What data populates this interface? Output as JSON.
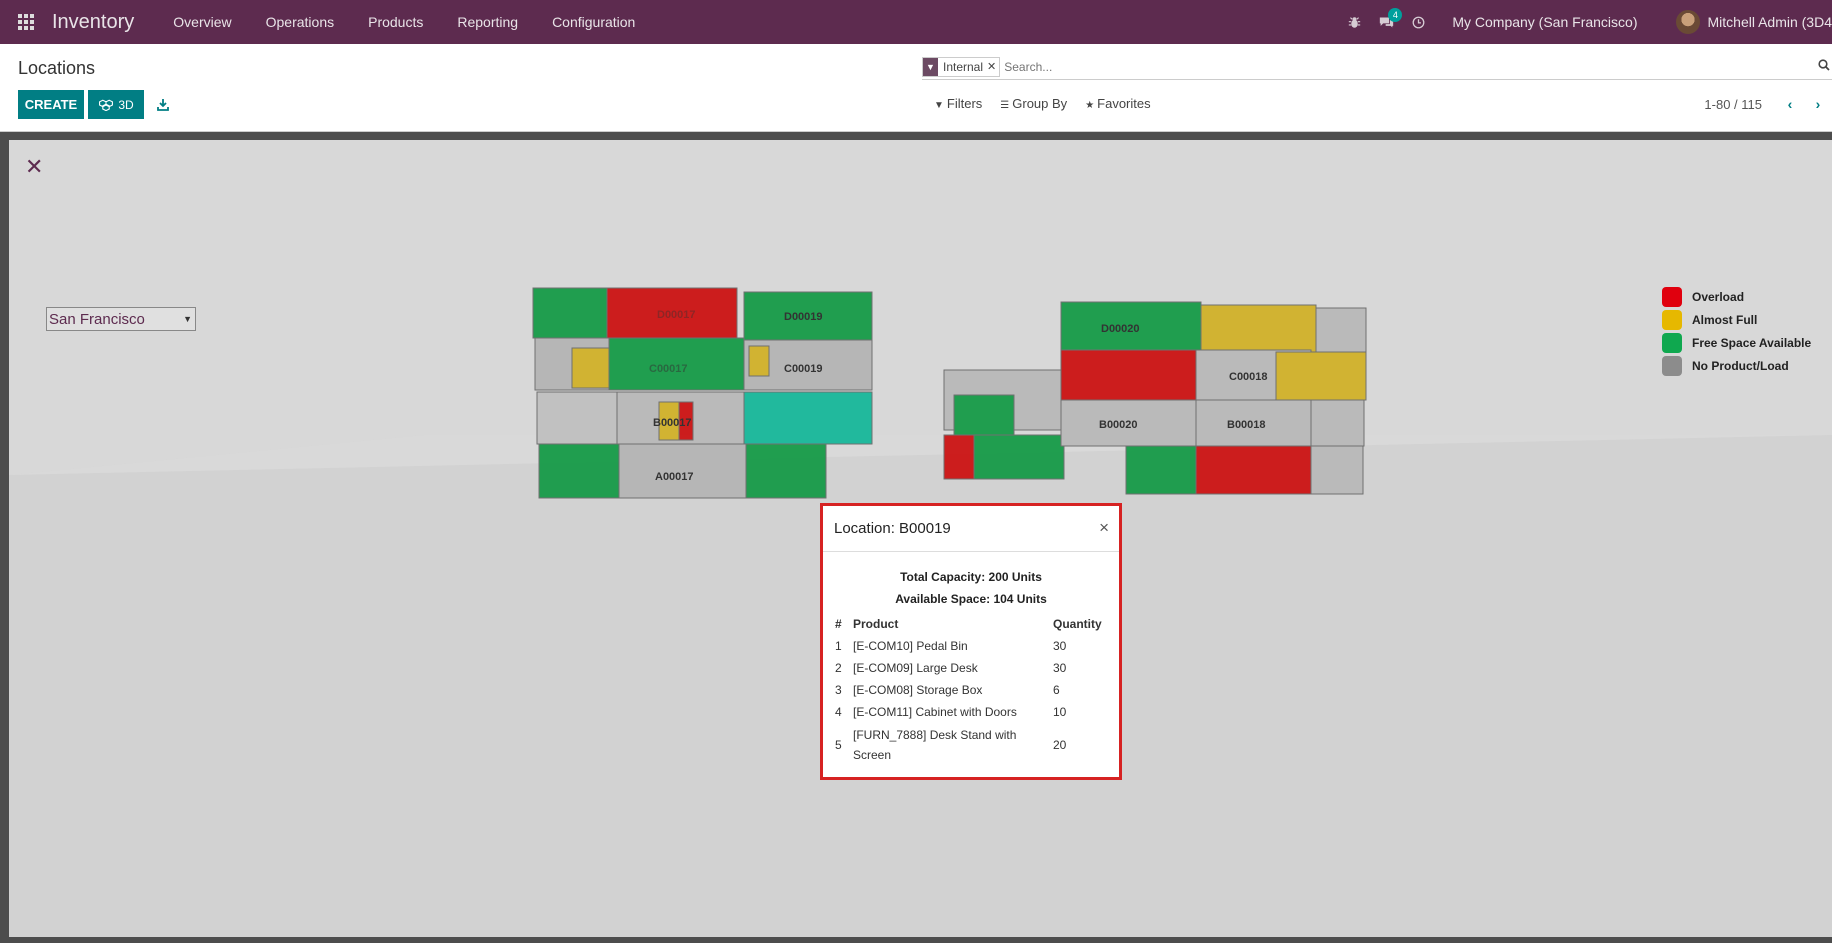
{
  "navbar": {
    "app_name": "Inventory",
    "menu": [
      "Overview",
      "Operations",
      "Products",
      "Reporting",
      "Configuration"
    ],
    "chat_badge": "4",
    "company": "My Company (San Francisco)",
    "user": "Mitchell Admin (3D4"
  },
  "control": {
    "title": "Locations",
    "create_label": "CREATE",
    "view_3d_label": "3D",
    "facet_label": "Internal",
    "search_placeholder": "Search...",
    "filters_label": "Filters",
    "groupby_label": "Group By",
    "favorites_label": "Favorites",
    "pager_value": "1-80 / 115"
  },
  "scene": {
    "warehouse_selected": "San Francisco",
    "legend": [
      {
        "label": "Overload",
        "color": "#e0000e"
      },
      {
        "label": "Almost Full",
        "color": "#e6b800"
      },
      {
        "label": "Free Space Available",
        "color": "#0fa84f"
      },
      {
        "label": "No Product/Load",
        "color": "#8c8c8c"
      }
    ],
    "bin_labels": [
      "D00019",
      "C00017",
      "C00019",
      "B00017",
      "A00017",
      "D00020",
      "C00018",
      "B00020",
      "B00018"
    ]
  },
  "popup": {
    "title": "Location: B00019",
    "close": "×",
    "total_capacity": "Total Capacity: 200 Units",
    "available_space": "Available Space: 104 Units",
    "headers": [
      "#",
      "Product",
      "Quantity"
    ],
    "rows": [
      {
        "n": "1",
        "product": "[E-COM10] Pedal Bin",
        "qty": "30"
      },
      {
        "n": "2",
        "product": "[E-COM09] Large Desk",
        "qty": "30"
      },
      {
        "n": "3",
        "product": "[E-COM08] Storage Box",
        "qty": "6"
      },
      {
        "n": "4",
        "product": "[E-COM11] Cabinet with Doors",
        "qty": "10"
      },
      {
        "n": "5",
        "product": "[FURN_7888] Desk Stand with Screen",
        "qty": "20"
      }
    ]
  }
}
